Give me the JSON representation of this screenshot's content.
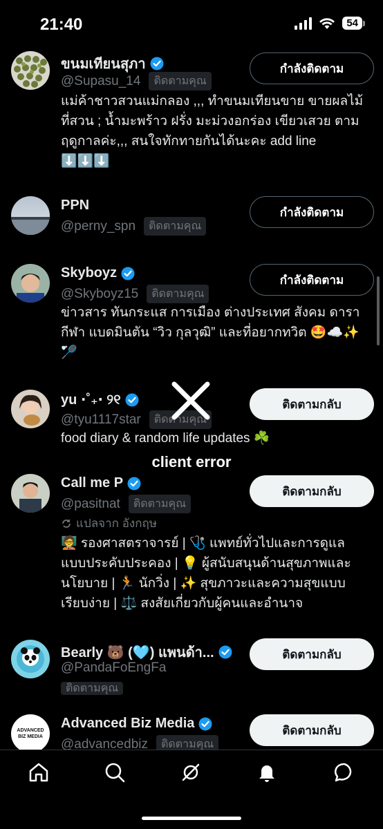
{
  "status_bar": {
    "time": "21:40",
    "battery": "54"
  },
  "accounts": [
    {
      "name": "ขนมเทียนสุภา",
      "verified": true,
      "handle": "@Supasu_14",
      "follows_you": "ติดตามคุณ",
      "button": "กำลังติดตาม",
      "bio": "แม่ค้าชาวสวนแม่กลอง ,,, ทำขนมเทียนขาย ขายผลไม้ที่สวน ; น้ำมะพร้าว ฝรั่ง มะม่วงอกร่อง เขียวเสวย ตามฤดูกาลค่ะ,,, สนใจทักทายกันได้นะคะ add line ⬇️⬇️⬇️"
    },
    {
      "name": "PPN",
      "verified": false,
      "handle": "@perny_spn",
      "follows_you": "ติดตามคุณ",
      "button": "กำลังติดตาม",
      "bio": ""
    },
    {
      "name": "Skyboyz",
      "verified": true,
      "handle": "@Skyboyz15",
      "follows_you": "ติดตามคุณ",
      "button": "กำลังติดตาม",
      "bio": "ข่าวสาร ทันกระแส การเมือง ต่างประเทศ สังคม ดารา กีฬา แบดมินตัน “วิว กุลวุฒิ” และที่อยากทวิต 🤩☁️✨🏸"
    },
    {
      "name": "yu ⋅˚₊‧ ୨୧",
      "verified": true,
      "handle": "@tyu1117star",
      "follows_you": "ติดตามคุณ",
      "button": "ติดตามกลับ",
      "bio": "food diary & random life updates ☘️"
    },
    {
      "name": "Call me P",
      "verified": true,
      "handle": "@pasitnat",
      "follows_you": "ติดตามคุณ",
      "button": "ติดตามกลับ",
      "translated": "แปลจาก อังกฤษ",
      "bio": "🧑‍🏫 รองศาสตราจารย์ | 🩺 แพทย์ทั่วไปและการดูแลแบบประคับประคอง | 💡 ผู้สนับสนุนด้านสุขภาพและนโยบาย | 🏃 นักวิ่ง | ✨ สุขภาวะและความสุขแบบเรียบง่าย | ⚖️ สงสัยเกี่ยวกับผู้คนและอำนาจ"
    },
    {
      "name": "Bearly 🐻 (🩵) แพนด้า...",
      "verified": true,
      "handle": "@PandaFoEngFa",
      "follows_you": "ติดตามคุณ",
      "button": "ติดตามกลับ",
      "bio": ""
    },
    {
      "name": "Advanced Biz Media",
      "verified": true,
      "handle": "@advancedbiz",
      "follows_you": "ติดตามคุณ",
      "button": "ติดตามกลับ",
      "bio": "",
      "avatar_text": "ADVANCED BIZ MEDIA"
    }
  ],
  "error": {
    "message": "client error"
  },
  "tabs": [
    "home-icon",
    "search-icon",
    "grok-icon",
    "notifications-icon",
    "messages-icon"
  ],
  "colors": {
    "verified": "#1d9bf0",
    "background": "#000000",
    "secondary_text": "#71767b"
  }
}
